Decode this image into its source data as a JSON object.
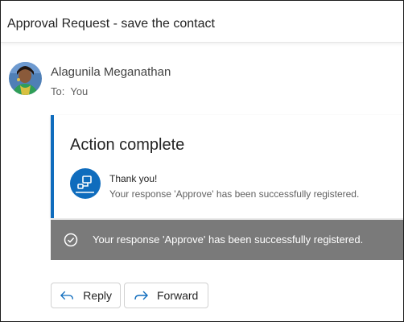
{
  "email": {
    "subject": "Approval Request - save the contact",
    "sender_name": "Alagunila Meganathan",
    "to_label": "To:",
    "to_value": "You"
  },
  "card": {
    "heading": "Action complete",
    "line1": "Thank you!",
    "line2": "Your response 'Approve' has been successfully registered.",
    "accent_color": "#0f6cbd",
    "icon": "power-automate-flow-icon"
  },
  "toast": {
    "message": "Your response 'Approve' has been successfully registered.",
    "icon": "checkmark-circle-icon",
    "background": "#7a7a7a"
  },
  "actions": {
    "reply_label": "Reply",
    "reply_icon": "reply-arrow-icon",
    "forward_label": "Forward",
    "forward_icon": "forward-arrow-icon"
  }
}
